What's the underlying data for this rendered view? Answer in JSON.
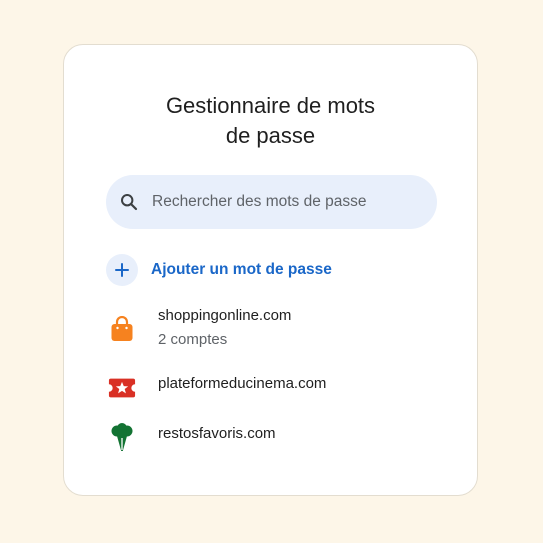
{
  "title": {
    "line1": "Gestionnaire de mots",
    "line2": "de passe"
  },
  "search": {
    "placeholder": "Rechercher des mots de passe",
    "icon": "search-icon"
  },
  "add_password": {
    "label": "Ajouter un mot de passe",
    "icon": "plus-icon"
  },
  "entries": [
    {
      "site": "shoppingonline.com",
      "subtitle": "2 comptes",
      "icon": "shopping-bag-icon",
      "color": "#f6821f"
    },
    {
      "site": "plateformeducinema.com",
      "subtitle": "",
      "icon": "ticket-star-icon",
      "color": "#d93025"
    },
    {
      "site": "restosfavoris.com",
      "subtitle": "",
      "icon": "broccoli-icon",
      "color": "#137333"
    }
  ],
  "colors": {
    "background": "#fdf6e8",
    "accent": "#1a67c8",
    "search_bg": "#e8effb"
  }
}
